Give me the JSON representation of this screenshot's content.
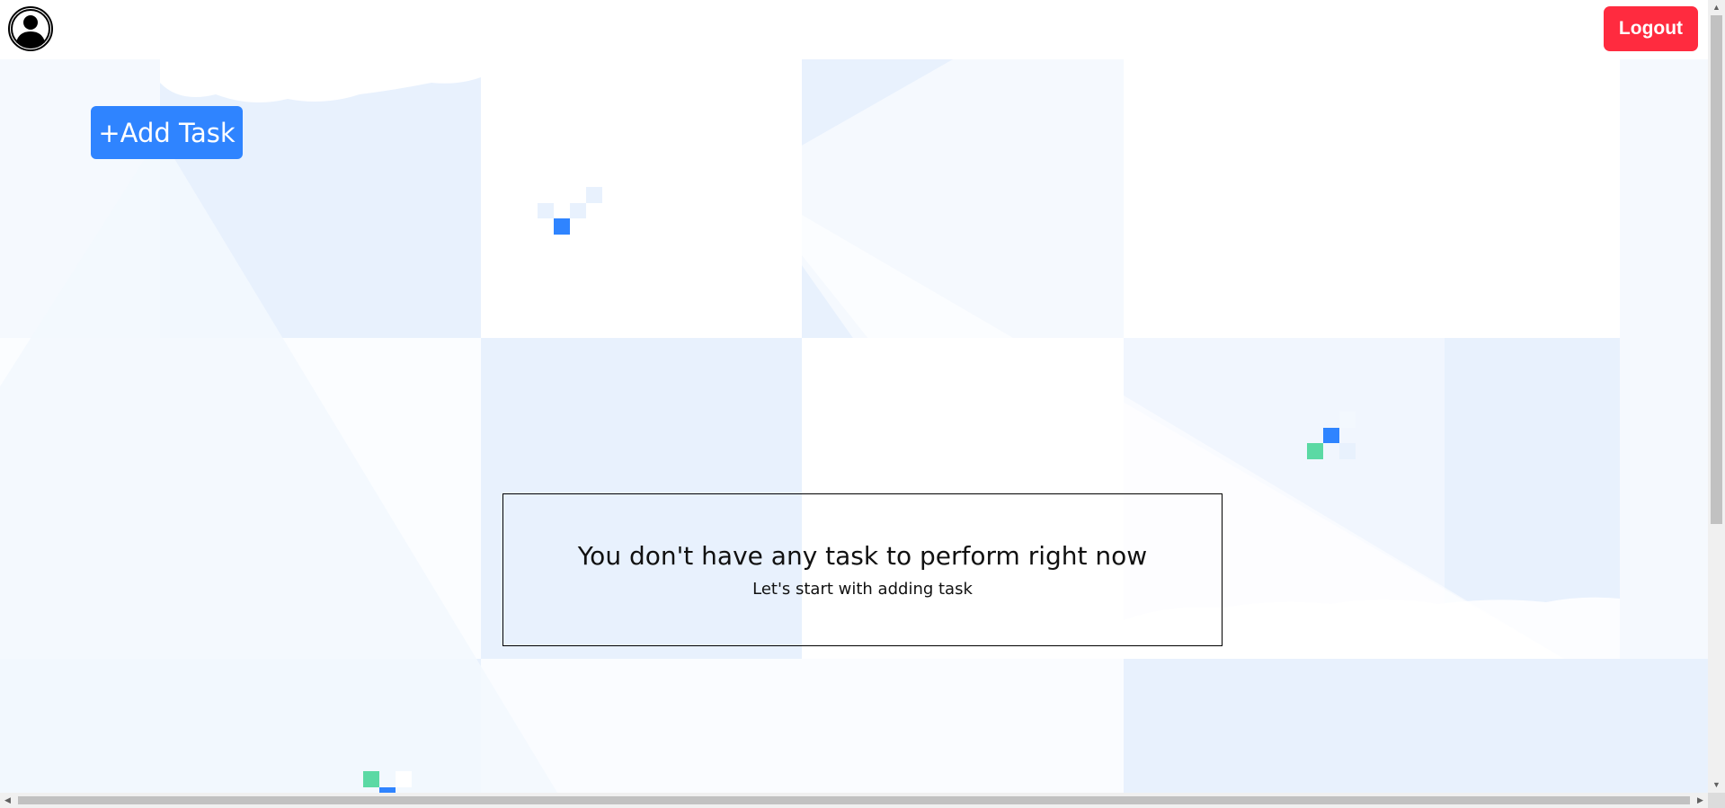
{
  "header": {
    "avatar_icon": "user-circle-icon",
    "logout_label": "Logout",
    "logout_color": "#ff2b3f"
  },
  "toolbar": {
    "add_task_label": "+Add Task",
    "add_task_color": "#2f84ff"
  },
  "empty_state": {
    "title": "You don't have any task to perform right now",
    "subtitle": "Let's start with adding task"
  },
  "theme": {
    "background_light_blue": "#e8f1fd",
    "background_pale_blue": "#f3f8fe",
    "accent_blue": "#2f84ff",
    "accent_green": "#5bd9a4"
  }
}
